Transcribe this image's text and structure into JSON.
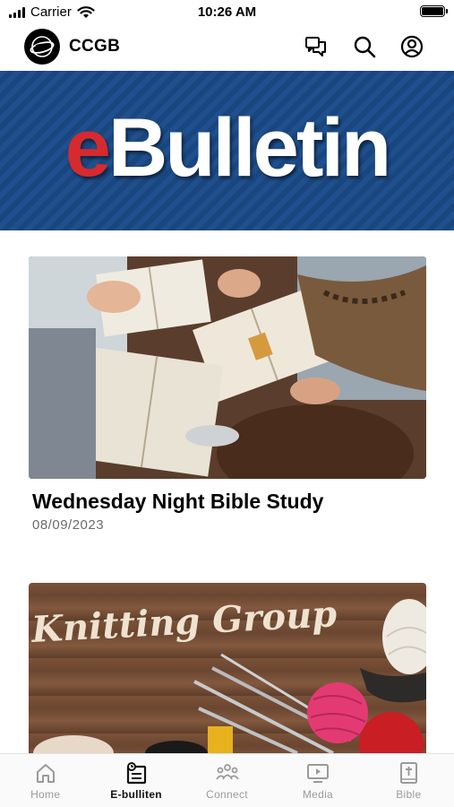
{
  "status_bar": {
    "carrier": "Carrier",
    "time": "10:26 AM"
  },
  "header": {
    "title": "CCGB",
    "icons": [
      "chat-icon",
      "search-icon",
      "profile-icon"
    ]
  },
  "banner": {
    "text_e": "e",
    "text_rest": "Bulletin"
  },
  "cards": [
    {
      "title": "Wednesday Night Bible Study",
      "date": "08/09/2023",
      "image": "bible-study-photo"
    },
    {
      "title": "",
      "date": "",
      "image": "knitting-group-photo",
      "image_text": "Knitting Group"
    }
  ],
  "tab_bar": {
    "active": "E-bulliten",
    "tabs": [
      {
        "label": "Home",
        "icon": "home-icon"
      },
      {
        "label": "E-bulliten",
        "icon": "bulletin-icon"
      },
      {
        "label": "Connect",
        "icon": "connect-icon"
      },
      {
        "label": "Media",
        "icon": "media-icon"
      },
      {
        "label": "Bible",
        "icon": "bible-icon"
      }
    ]
  },
  "colors": {
    "banner_blue": "#1f4f8c",
    "banner_red": "#d62a2f",
    "tab_inactive": "#9a9a9a"
  }
}
